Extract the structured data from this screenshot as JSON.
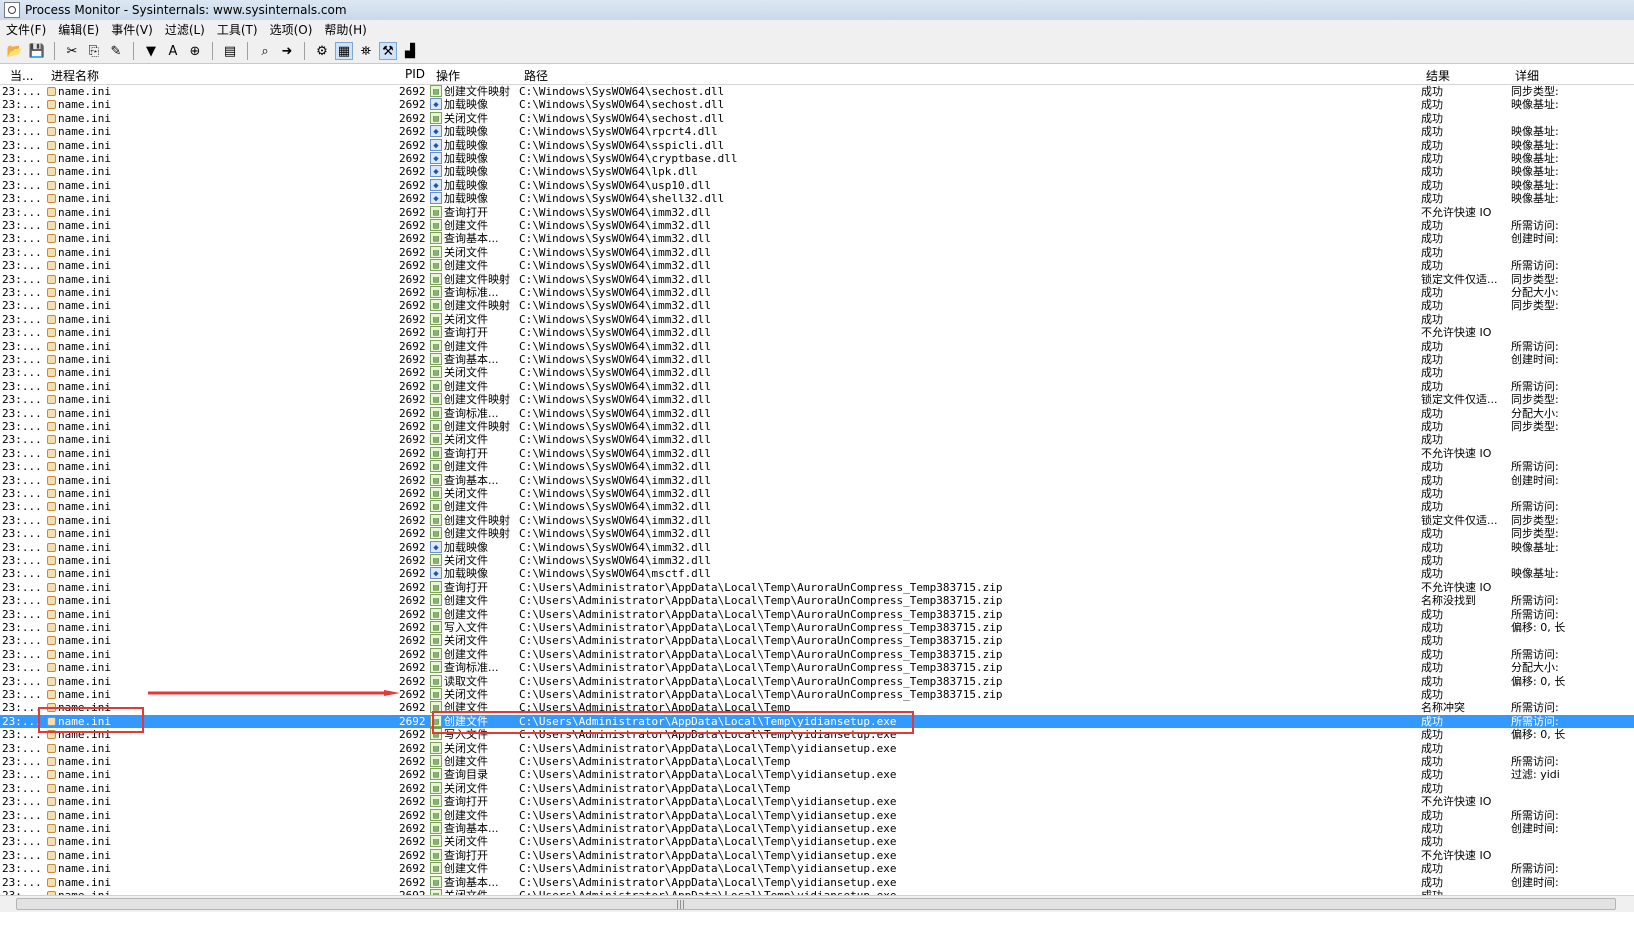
{
  "window": {
    "title": "Process Monitor - Sysinternals: www.sysinternals.com"
  },
  "menu": [
    "文件(F)",
    "编辑(E)",
    "事件(V)",
    "过滤(L)",
    "工具(T)",
    "选项(O)",
    "帮助(H)"
  ],
  "toolbar": [
    {
      "icon": "open-folder-icon",
      "glyph": "📂"
    },
    {
      "icon": "save-icon",
      "glyph": "💾"
    },
    {
      "sep": true
    },
    {
      "icon": "capture-icon",
      "glyph": "✂"
    },
    {
      "icon": "autoscroll-icon",
      "glyph": "⎘"
    },
    {
      "icon": "clear-icon",
      "glyph": "✎"
    },
    {
      "sep": true
    },
    {
      "icon": "filter-icon",
      "glyph": "▼"
    },
    {
      "icon": "highlight-icon",
      "glyph": "A"
    },
    {
      "icon": "include-icon",
      "glyph": "⊕"
    },
    {
      "sep": true
    },
    {
      "icon": "process-tree-icon",
      "glyph": "▤"
    },
    {
      "sep": true
    },
    {
      "icon": "find-icon",
      "glyph": "⌕"
    },
    {
      "icon": "jump-icon",
      "glyph": "➜"
    },
    {
      "sep": true
    },
    {
      "icon": "registry-activity-icon",
      "glyph": "⚙"
    },
    {
      "icon": "file-activity-icon",
      "glyph": "▦",
      "pressed": true
    },
    {
      "icon": "network-activity-icon",
      "glyph": "⛯"
    },
    {
      "icon": "process-activity-icon",
      "glyph": "⚒",
      "pressed": true
    },
    {
      "icon": "profiling-icon",
      "glyph": "▟"
    }
  ],
  "columns": {
    "time": "当...",
    "process": "进程名称",
    "pid": "PID",
    "operation": "操作",
    "path": "路径",
    "result": "结果",
    "detail": "详细"
  },
  "process": "name.ini",
  "pid": "2692",
  "time": "23:...",
  "rows": [
    {
      "op": "创建文件映射",
      "kind": "file",
      "path": "C:\\Windows\\SysWOW64\\sechost.dll",
      "res": "成功",
      "det": "同步类型:"
    },
    {
      "op": "加载映像",
      "kind": "img",
      "path": "C:\\Windows\\SysWOW64\\sechost.dll",
      "res": "成功",
      "det": "映像基址:"
    },
    {
      "op": "关闭文件",
      "kind": "file",
      "path": "C:\\Windows\\SysWOW64\\sechost.dll",
      "res": "成功",
      "det": ""
    },
    {
      "op": "加载映像",
      "kind": "img",
      "path": "C:\\Windows\\SysWOW64\\rpcrt4.dll",
      "res": "成功",
      "det": "映像基址:"
    },
    {
      "op": "加载映像",
      "kind": "img",
      "path": "C:\\Windows\\SysWOW64\\sspicli.dll",
      "res": "成功",
      "det": "映像基址:"
    },
    {
      "op": "加载映像",
      "kind": "img",
      "path": "C:\\Windows\\SysWOW64\\cryptbase.dll",
      "res": "成功",
      "det": "映像基址:"
    },
    {
      "op": "加载映像",
      "kind": "img",
      "path": "C:\\Windows\\SysWOW64\\lpk.dll",
      "res": "成功",
      "det": "映像基址:"
    },
    {
      "op": "加载映像",
      "kind": "img",
      "path": "C:\\Windows\\SysWOW64\\usp10.dll",
      "res": "成功",
      "det": "映像基址:"
    },
    {
      "op": "加载映像",
      "kind": "img",
      "path": "C:\\Windows\\SysWOW64\\shell32.dll",
      "res": "成功",
      "det": "映像基址:"
    },
    {
      "op": "查询打开",
      "kind": "file",
      "path": "C:\\Windows\\SysWOW64\\imm32.dll",
      "res": "不允许快速 IO",
      "det": ""
    },
    {
      "op": "创建文件",
      "kind": "file",
      "path": "C:\\Windows\\SysWOW64\\imm32.dll",
      "res": "成功",
      "det": "所需访问:"
    },
    {
      "op": "查询基本...",
      "kind": "file",
      "path": "C:\\Windows\\SysWOW64\\imm32.dll",
      "res": "成功",
      "det": "创建时间:"
    },
    {
      "op": "关闭文件",
      "kind": "file",
      "path": "C:\\Windows\\SysWOW64\\imm32.dll",
      "res": "成功",
      "det": ""
    },
    {
      "op": "创建文件",
      "kind": "file",
      "path": "C:\\Windows\\SysWOW64\\imm32.dll",
      "res": "成功",
      "det": "所需访问:"
    },
    {
      "op": "创建文件映射",
      "kind": "file",
      "path": "C:\\Windows\\SysWOW64\\imm32.dll",
      "res": "锁定文件仅适...",
      "det": "同步类型:"
    },
    {
      "op": "查询标准...",
      "kind": "file",
      "path": "C:\\Windows\\SysWOW64\\imm32.dll",
      "res": "成功",
      "det": "分配大小:"
    },
    {
      "op": "创建文件映射",
      "kind": "file",
      "path": "C:\\Windows\\SysWOW64\\imm32.dll",
      "res": "成功",
      "det": "同步类型:"
    },
    {
      "op": "关闭文件",
      "kind": "file",
      "path": "C:\\Windows\\SysWOW64\\imm32.dll",
      "res": "成功",
      "det": ""
    },
    {
      "op": "查询打开",
      "kind": "file",
      "path": "C:\\Windows\\SysWOW64\\imm32.dll",
      "res": "不允许快速 IO",
      "det": ""
    },
    {
      "op": "创建文件",
      "kind": "file",
      "path": "C:\\Windows\\SysWOW64\\imm32.dll",
      "res": "成功",
      "det": "所需访问:"
    },
    {
      "op": "查询基本...",
      "kind": "file",
      "path": "C:\\Windows\\SysWOW64\\imm32.dll",
      "res": "成功",
      "det": "创建时间:"
    },
    {
      "op": "关闭文件",
      "kind": "file",
      "path": "C:\\Windows\\SysWOW64\\imm32.dll",
      "res": "成功",
      "det": ""
    },
    {
      "op": "创建文件",
      "kind": "file",
      "path": "C:\\Windows\\SysWOW64\\imm32.dll",
      "res": "成功",
      "det": "所需访问:"
    },
    {
      "op": "创建文件映射",
      "kind": "file",
      "path": "C:\\Windows\\SysWOW64\\imm32.dll",
      "res": "锁定文件仅适...",
      "det": "同步类型:"
    },
    {
      "op": "查询标准...",
      "kind": "file",
      "path": "C:\\Windows\\SysWOW64\\imm32.dll",
      "res": "成功",
      "det": "分配大小:"
    },
    {
      "op": "创建文件映射",
      "kind": "file",
      "path": "C:\\Windows\\SysWOW64\\imm32.dll",
      "res": "成功",
      "det": "同步类型:"
    },
    {
      "op": "关闭文件",
      "kind": "file",
      "path": "C:\\Windows\\SysWOW64\\imm32.dll",
      "res": "成功",
      "det": ""
    },
    {
      "op": "查询打开",
      "kind": "file",
      "path": "C:\\Windows\\SysWOW64\\imm32.dll",
      "res": "不允许快速 IO",
      "det": ""
    },
    {
      "op": "创建文件",
      "kind": "file",
      "path": "C:\\Windows\\SysWOW64\\imm32.dll",
      "res": "成功",
      "det": "所需访问:"
    },
    {
      "op": "查询基本...",
      "kind": "file",
      "path": "C:\\Windows\\SysWOW64\\imm32.dll",
      "res": "成功",
      "det": "创建时间:"
    },
    {
      "op": "关闭文件",
      "kind": "file",
      "path": "C:\\Windows\\SysWOW64\\imm32.dll",
      "res": "成功",
      "det": ""
    },
    {
      "op": "创建文件",
      "kind": "file",
      "path": "C:\\Windows\\SysWOW64\\imm32.dll",
      "res": "成功",
      "det": "所需访问:"
    },
    {
      "op": "创建文件映射",
      "kind": "file",
      "path": "C:\\Windows\\SysWOW64\\imm32.dll",
      "res": "锁定文件仅适...",
      "det": "同步类型:"
    },
    {
      "op": "创建文件映射",
      "kind": "file",
      "path": "C:\\Windows\\SysWOW64\\imm32.dll",
      "res": "成功",
      "det": "同步类型:"
    },
    {
      "op": "加载映像",
      "kind": "img",
      "path": "C:\\Windows\\SysWOW64\\imm32.dll",
      "res": "成功",
      "det": "映像基址:"
    },
    {
      "op": "关闭文件",
      "kind": "file",
      "path": "C:\\Windows\\SysWOW64\\imm32.dll",
      "res": "成功",
      "det": ""
    },
    {
      "op": "加载映像",
      "kind": "img",
      "path": "C:\\Windows\\SysWOW64\\msctf.dll",
      "res": "成功",
      "det": "映像基址:"
    },
    {
      "op": "查询打开",
      "kind": "file",
      "path": "C:\\Users\\Administrator\\AppData\\Local\\Temp\\AuroraUnCompress_Temp383715.zip",
      "res": "不允许快速 IO",
      "det": ""
    },
    {
      "op": "创建文件",
      "kind": "file",
      "path": "C:\\Users\\Administrator\\AppData\\Local\\Temp\\AuroraUnCompress_Temp383715.zip",
      "res": "名称没找到",
      "det": "所需访问:"
    },
    {
      "op": "创建文件",
      "kind": "file",
      "path": "C:\\Users\\Administrator\\AppData\\Local\\Temp\\AuroraUnCompress_Temp383715.zip",
      "res": "成功",
      "det": "所需访问:"
    },
    {
      "op": "写入文件",
      "kind": "file",
      "path": "C:\\Users\\Administrator\\AppData\\Local\\Temp\\AuroraUnCompress_Temp383715.zip",
      "res": "成功",
      "det": "偏移: 0, 长"
    },
    {
      "op": "关闭文件",
      "kind": "file",
      "path": "C:\\Users\\Administrator\\AppData\\Local\\Temp\\AuroraUnCompress_Temp383715.zip",
      "res": "成功",
      "det": ""
    },
    {
      "op": "创建文件",
      "kind": "file",
      "path": "C:\\Users\\Administrator\\AppData\\Local\\Temp\\AuroraUnCompress_Temp383715.zip",
      "res": "成功",
      "det": "所需访问:"
    },
    {
      "op": "查询标准...",
      "kind": "file",
      "path": "C:\\Users\\Administrator\\AppData\\Local\\Temp\\AuroraUnCompress_Temp383715.zip",
      "res": "成功",
      "det": "分配大小:"
    },
    {
      "op": "读取文件",
      "kind": "file",
      "path": "C:\\Users\\Administrator\\AppData\\Local\\Temp\\AuroraUnCompress_Temp383715.zip",
      "res": "成功",
      "det": "偏移: 0, 长"
    },
    {
      "op": "关闭文件",
      "kind": "file",
      "path": "C:\\Users\\Administrator\\AppData\\Local\\Temp\\AuroraUnCompress_Temp383715.zip",
      "res": "成功",
      "det": ""
    },
    {
      "op": "创建文件",
      "kind": "file",
      "path": "C:\\Users\\Administrator\\AppData\\Local\\Temp",
      "res": "名称冲突",
      "det": "所需访问:"
    },
    {
      "op": "创建文件",
      "kind": "file",
      "path": "C:\\Users\\Administrator\\AppData\\Local\\Temp\\yidiansetup.exe",
      "res": "成功",
      "det": "所需访问:",
      "sel": true
    },
    {
      "op": "写入文件",
      "kind": "file",
      "path": "C:\\Users\\Administrator\\AppData\\Local\\Temp\\yidiansetup.exe",
      "res": "成功",
      "det": "偏移: 0, 长"
    },
    {
      "op": "关闭文件",
      "kind": "file",
      "path": "C:\\Users\\Administrator\\AppData\\Local\\Temp\\yidiansetup.exe",
      "res": "成功",
      "det": ""
    },
    {
      "op": "创建文件",
      "kind": "file",
      "path": "C:\\Users\\Administrator\\AppData\\Local\\Temp",
      "res": "成功",
      "det": "所需访问:"
    },
    {
      "op": "查询目录",
      "kind": "file",
      "path": "C:\\Users\\Administrator\\AppData\\Local\\Temp\\yidiansetup.exe",
      "res": "成功",
      "det": "过滤: yidi"
    },
    {
      "op": "关闭文件",
      "kind": "file",
      "path": "C:\\Users\\Administrator\\AppData\\Local\\Temp",
      "res": "成功",
      "det": ""
    },
    {
      "op": "查询打开",
      "kind": "file",
      "path": "C:\\Users\\Administrator\\AppData\\Local\\Temp\\yidiansetup.exe",
      "res": "不允许快速 IO",
      "det": ""
    },
    {
      "op": "创建文件",
      "kind": "file",
      "path": "C:\\Users\\Administrator\\AppData\\Local\\Temp\\yidiansetup.exe",
      "res": "成功",
      "det": "所需访问:"
    },
    {
      "op": "查询基本...",
      "kind": "file",
      "path": "C:\\Users\\Administrator\\AppData\\Local\\Temp\\yidiansetup.exe",
      "res": "成功",
      "det": "创建时间:"
    },
    {
      "op": "关闭文件",
      "kind": "file",
      "path": "C:\\Users\\Administrator\\AppData\\Local\\Temp\\yidiansetup.exe",
      "res": "成功",
      "det": ""
    },
    {
      "op": "查询打开",
      "kind": "file",
      "path": "C:\\Users\\Administrator\\AppData\\Local\\Temp\\yidiansetup.exe",
      "res": "不允许快速 IO",
      "det": ""
    },
    {
      "op": "创建文件",
      "kind": "file",
      "path": "C:\\Users\\Administrator\\AppData\\Local\\Temp\\yidiansetup.exe",
      "res": "成功",
      "det": "所需访问:"
    },
    {
      "op": "查询基本...",
      "kind": "file",
      "path": "C:\\Users\\Administrator\\AppData\\Local\\Temp\\yidiansetup.exe",
      "res": "成功",
      "det": "创建时间:"
    },
    {
      "op": "关闭文件",
      "kind": "file",
      "path": "C:\\Users\\Administrator\\AppData\\Local\\Temp\\yidiansetup.exe",
      "res": "成功",
      "det": ""
    }
  ],
  "annotation_color": "#e53935",
  "selection_color": "#3399ff"
}
